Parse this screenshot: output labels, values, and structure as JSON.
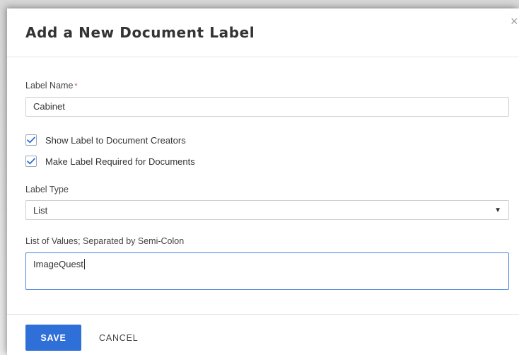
{
  "dialog": {
    "title": "Add a New Document Label",
    "close_symbol": "×"
  },
  "form": {
    "label_name": {
      "label": "Label Name",
      "required_mark": "*",
      "value": "Cabinet"
    },
    "show_to_creators": {
      "label": "Show Label to Document Creators",
      "checked": true
    },
    "make_required": {
      "label": "Make Label Required for Documents",
      "checked": true
    },
    "label_type": {
      "label": "Label Type",
      "selected": "List"
    },
    "list_values": {
      "label": "List of Values; Separated by Semi-Colon",
      "value": "ImageQuest"
    }
  },
  "footer": {
    "save_label": "SAVE",
    "cancel_label": "CANCEL"
  },
  "icons": {
    "checkmark": "check-icon",
    "dropdown": "caret-down-icon",
    "close": "close-icon"
  },
  "colors": {
    "primary": "#2f6fd8",
    "checkmark": "#2f6fd8",
    "focus_border": "#4a86d8",
    "required": "#e05a5a"
  }
}
